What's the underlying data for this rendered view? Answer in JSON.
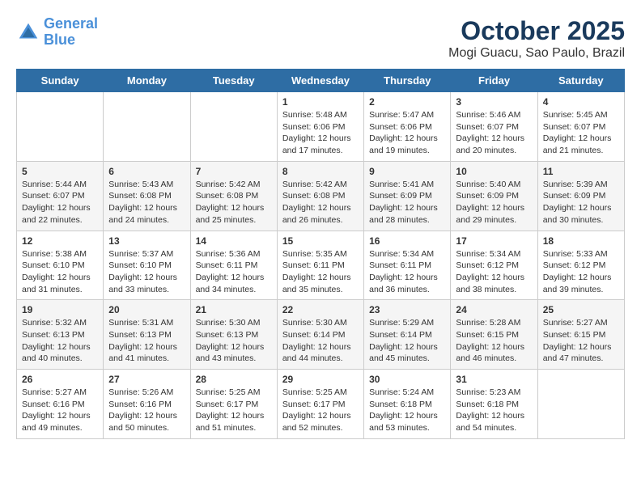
{
  "header": {
    "logo_line1": "General",
    "logo_line2": "Blue",
    "month": "October 2025",
    "location": "Mogi Guacu, Sao Paulo, Brazil"
  },
  "weekdays": [
    "Sunday",
    "Monday",
    "Tuesday",
    "Wednesday",
    "Thursday",
    "Friday",
    "Saturday"
  ],
  "weeks": [
    [
      {
        "day": "",
        "sunrise": "",
        "sunset": "",
        "daylight": ""
      },
      {
        "day": "",
        "sunrise": "",
        "sunset": "",
        "daylight": ""
      },
      {
        "day": "",
        "sunrise": "",
        "sunset": "",
        "daylight": ""
      },
      {
        "day": "1",
        "sunrise": "Sunrise: 5:48 AM",
        "sunset": "Sunset: 6:06 PM",
        "daylight": "Daylight: 12 hours and 17 minutes."
      },
      {
        "day": "2",
        "sunrise": "Sunrise: 5:47 AM",
        "sunset": "Sunset: 6:06 PM",
        "daylight": "Daylight: 12 hours and 19 minutes."
      },
      {
        "day": "3",
        "sunrise": "Sunrise: 5:46 AM",
        "sunset": "Sunset: 6:07 PM",
        "daylight": "Daylight: 12 hours and 20 minutes."
      },
      {
        "day": "4",
        "sunrise": "Sunrise: 5:45 AM",
        "sunset": "Sunset: 6:07 PM",
        "daylight": "Daylight: 12 hours and 21 minutes."
      }
    ],
    [
      {
        "day": "5",
        "sunrise": "Sunrise: 5:44 AM",
        "sunset": "Sunset: 6:07 PM",
        "daylight": "Daylight: 12 hours and 22 minutes."
      },
      {
        "day": "6",
        "sunrise": "Sunrise: 5:43 AM",
        "sunset": "Sunset: 6:08 PM",
        "daylight": "Daylight: 12 hours and 24 minutes."
      },
      {
        "day": "7",
        "sunrise": "Sunrise: 5:42 AM",
        "sunset": "Sunset: 6:08 PM",
        "daylight": "Daylight: 12 hours and 25 minutes."
      },
      {
        "day": "8",
        "sunrise": "Sunrise: 5:42 AM",
        "sunset": "Sunset: 6:08 PM",
        "daylight": "Daylight: 12 hours and 26 minutes."
      },
      {
        "day": "9",
        "sunrise": "Sunrise: 5:41 AM",
        "sunset": "Sunset: 6:09 PM",
        "daylight": "Daylight: 12 hours and 28 minutes."
      },
      {
        "day": "10",
        "sunrise": "Sunrise: 5:40 AM",
        "sunset": "Sunset: 6:09 PM",
        "daylight": "Daylight: 12 hours and 29 minutes."
      },
      {
        "day": "11",
        "sunrise": "Sunrise: 5:39 AM",
        "sunset": "Sunset: 6:09 PM",
        "daylight": "Daylight: 12 hours and 30 minutes."
      }
    ],
    [
      {
        "day": "12",
        "sunrise": "Sunrise: 5:38 AM",
        "sunset": "Sunset: 6:10 PM",
        "daylight": "Daylight: 12 hours and 31 minutes."
      },
      {
        "day": "13",
        "sunrise": "Sunrise: 5:37 AM",
        "sunset": "Sunset: 6:10 PM",
        "daylight": "Daylight: 12 hours and 33 minutes."
      },
      {
        "day": "14",
        "sunrise": "Sunrise: 5:36 AM",
        "sunset": "Sunset: 6:11 PM",
        "daylight": "Daylight: 12 hours and 34 minutes."
      },
      {
        "day": "15",
        "sunrise": "Sunrise: 5:35 AM",
        "sunset": "Sunset: 6:11 PM",
        "daylight": "Daylight: 12 hours and 35 minutes."
      },
      {
        "day": "16",
        "sunrise": "Sunrise: 5:34 AM",
        "sunset": "Sunset: 6:11 PM",
        "daylight": "Daylight: 12 hours and 36 minutes."
      },
      {
        "day": "17",
        "sunrise": "Sunrise: 5:34 AM",
        "sunset": "Sunset: 6:12 PM",
        "daylight": "Daylight: 12 hours and 38 minutes."
      },
      {
        "day": "18",
        "sunrise": "Sunrise: 5:33 AM",
        "sunset": "Sunset: 6:12 PM",
        "daylight": "Daylight: 12 hours and 39 minutes."
      }
    ],
    [
      {
        "day": "19",
        "sunrise": "Sunrise: 5:32 AM",
        "sunset": "Sunset: 6:13 PM",
        "daylight": "Daylight: 12 hours and 40 minutes."
      },
      {
        "day": "20",
        "sunrise": "Sunrise: 5:31 AM",
        "sunset": "Sunset: 6:13 PM",
        "daylight": "Daylight: 12 hours and 41 minutes."
      },
      {
        "day": "21",
        "sunrise": "Sunrise: 5:30 AM",
        "sunset": "Sunset: 6:13 PM",
        "daylight": "Daylight: 12 hours and 43 minutes."
      },
      {
        "day": "22",
        "sunrise": "Sunrise: 5:30 AM",
        "sunset": "Sunset: 6:14 PM",
        "daylight": "Daylight: 12 hours and 44 minutes."
      },
      {
        "day": "23",
        "sunrise": "Sunrise: 5:29 AM",
        "sunset": "Sunset: 6:14 PM",
        "daylight": "Daylight: 12 hours and 45 minutes."
      },
      {
        "day": "24",
        "sunrise": "Sunrise: 5:28 AM",
        "sunset": "Sunset: 6:15 PM",
        "daylight": "Daylight: 12 hours and 46 minutes."
      },
      {
        "day": "25",
        "sunrise": "Sunrise: 5:27 AM",
        "sunset": "Sunset: 6:15 PM",
        "daylight": "Daylight: 12 hours and 47 minutes."
      }
    ],
    [
      {
        "day": "26",
        "sunrise": "Sunrise: 5:27 AM",
        "sunset": "Sunset: 6:16 PM",
        "daylight": "Daylight: 12 hours and 49 minutes."
      },
      {
        "day": "27",
        "sunrise": "Sunrise: 5:26 AM",
        "sunset": "Sunset: 6:16 PM",
        "daylight": "Daylight: 12 hours and 50 minutes."
      },
      {
        "day": "28",
        "sunrise": "Sunrise: 5:25 AM",
        "sunset": "Sunset: 6:17 PM",
        "daylight": "Daylight: 12 hours and 51 minutes."
      },
      {
        "day": "29",
        "sunrise": "Sunrise: 5:25 AM",
        "sunset": "Sunset: 6:17 PM",
        "daylight": "Daylight: 12 hours and 52 minutes."
      },
      {
        "day": "30",
        "sunrise": "Sunrise: 5:24 AM",
        "sunset": "Sunset: 6:18 PM",
        "daylight": "Daylight: 12 hours and 53 minutes."
      },
      {
        "day": "31",
        "sunrise": "Sunrise: 5:23 AM",
        "sunset": "Sunset: 6:18 PM",
        "daylight": "Daylight: 12 hours and 54 minutes."
      },
      {
        "day": "",
        "sunrise": "",
        "sunset": "",
        "daylight": ""
      }
    ]
  ]
}
